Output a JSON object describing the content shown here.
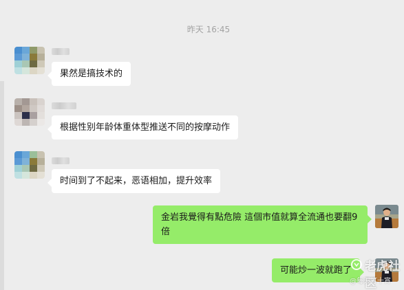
{
  "chat": {
    "timestamp": "昨天 16:45",
    "messages": [
      {
        "side": "left",
        "text": "果然是搞技术的"
      },
      {
        "side": "left",
        "text": "根据性别年龄体重体型推送不同的按摩动作"
      },
      {
        "side": "left",
        "text": "时间到了不起来，恶语相加，提升效率"
      },
      {
        "side": "right",
        "text": "金岩我覺得有點危險 這個市值就算全流通也要翻9倍"
      },
      {
        "side": "right",
        "text": "可能炒一波就跑了"
      }
    ]
  },
  "watermark": {
    "main": "老虎社区",
    "sub": "@每天打十宵"
  },
  "colors": {
    "background": "#ededed",
    "incoming_bubble": "#ffffff",
    "outgoing_bubble": "#95ec69",
    "timestamp_text": "#a3a3a3"
  },
  "icons": {
    "sender_avatar": "pixelated-avatar",
    "self_avatar": "profile-photo-avatar",
    "watermark_logo": "tiger-logo-icon"
  }
}
